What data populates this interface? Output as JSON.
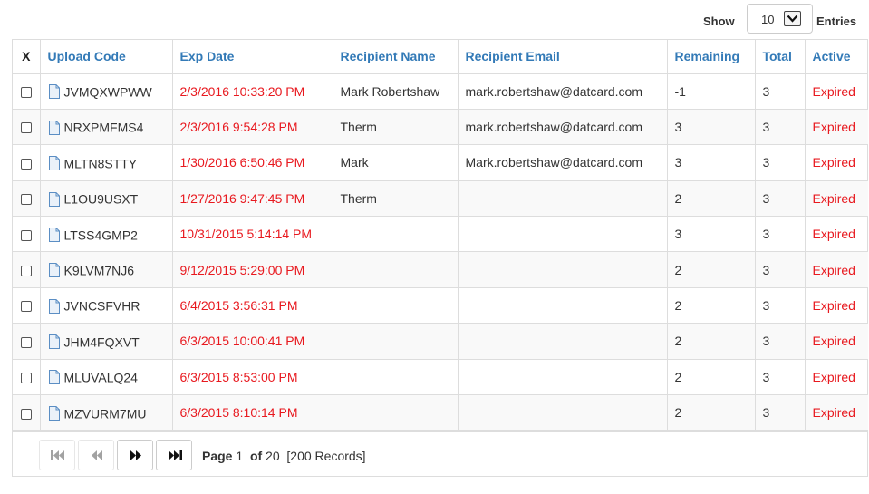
{
  "controls": {
    "show_label": "Show",
    "entries_value": "10",
    "entries_label": "Entries"
  },
  "columns": [
    "X",
    "Upload Code",
    "Exp Date",
    "Recipient Name",
    "Recipient Email",
    "Remaining",
    "Total",
    "Active"
  ],
  "rows": [
    {
      "code": "JVMQXWPWW",
      "exp": "2/3/2016 10:33:20 PM",
      "name": "Mark Robertshaw",
      "email": "mark.robertshaw@datcard.com",
      "remaining": "-1",
      "total": "3",
      "active": "Expired"
    },
    {
      "code": "NRXPMFMS4",
      "exp": "2/3/2016 9:54:28 PM",
      "name": "Therm",
      "email": "mark.robertshaw@datcard.com",
      "remaining": "3",
      "total": "3",
      "active": "Expired"
    },
    {
      "code": "MLTN8STTY",
      "exp": "1/30/2016 6:50:46 PM",
      "name": "Mark",
      "email": "Mark.robertshaw@datcard.com",
      "remaining": "3",
      "total": "3",
      "active": "Expired"
    },
    {
      "code": "L1OU9USXT",
      "exp": "1/27/2016 9:47:45 PM",
      "name": "Therm",
      "email": "",
      "remaining": "2",
      "total": "3",
      "active": "Expired"
    },
    {
      "code": "LTSS4GMP2",
      "exp": "10/31/2015 5:14:14 PM",
      "name": "",
      "email": "",
      "remaining": "3",
      "total": "3",
      "active": "Expired"
    },
    {
      "code": "K9LVM7NJ6",
      "exp": "9/12/2015 5:29:00 PM",
      "name": "",
      "email": "",
      "remaining": "2",
      "total": "3",
      "active": "Expired"
    },
    {
      "code": "JVNCSFVHR",
      "exp": "6/4/2015 3:56:31 PM",
      "name": "",
      "email": "",
      "remaining": "2",
      "total": "3",
      "active": "Expired"
    },
    {
      "code": "JHM4FQXVT",
      "exp": "6/3/2015 10:00:41 PM",
      "name": "",
      "email": "",
      "remaining": "2",
      "total": "3",
      "active": "Expired"
    },
    {
      "code": "MLUVALQ24",
      "exp": "6/3/2015 8:53:00 PM",
      "name": "",
      "email": "",
      "remaining": "2",
      "total": "3",
      "active": "Expired"
    },
    {
      "code": "MZVURM7MU",
      "exp": "6/3/2015 8:10:14 PM",
      "name": "",
      "email": "",
      "remaining": "2",
      "total": "3",
      "active": "Expired"
    }
  ],
  "pager": {
    "page_word": "Page",
    "current_page": "1",
    "of_word": "of",
    "total_pages": "20",
    "records": "[200 Records]"
  },
  "colors": {
    "header_text": "#337ab7",
    "expired_text": "#e8191f",
    "border": "#dddddd"
  },
  "icons": {
    "row": "file-icon",
    "first": "first-page-icon",
    "prev": "previous-page-icon",
    "next": "next-page-icon",
    "last": "last-page-icon",
    "dropdown": "chevron-down-icon"
  }
}
